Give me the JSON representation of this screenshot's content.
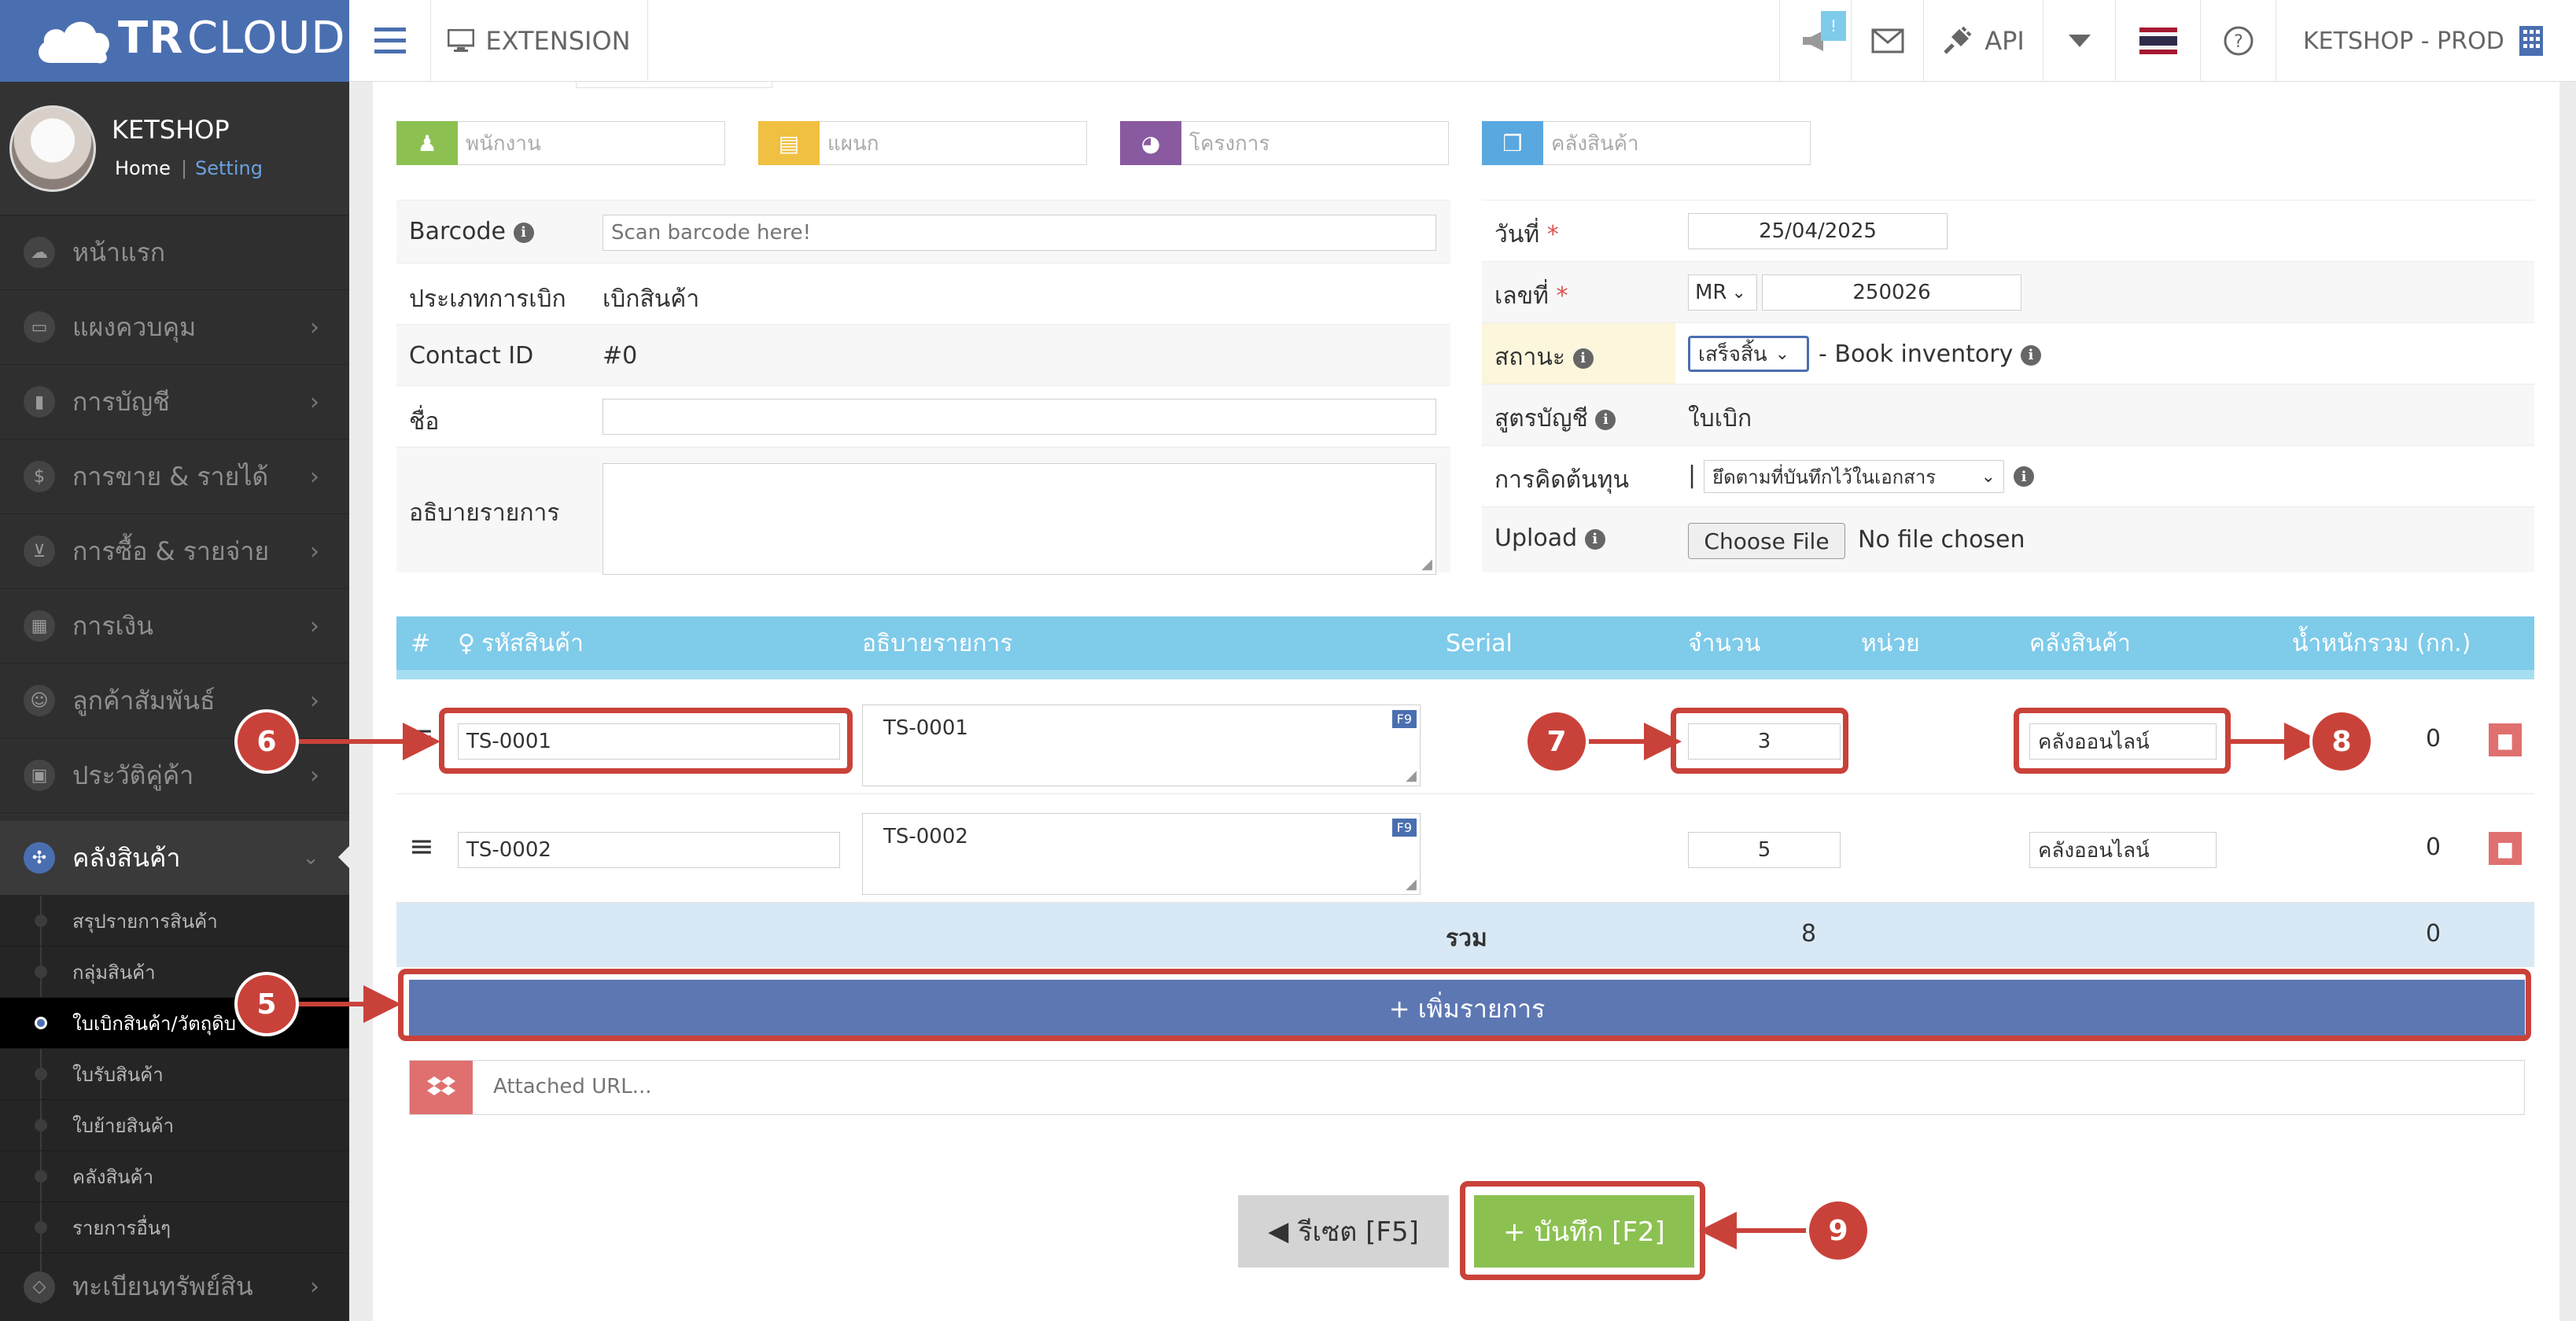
{
  "brand": {
    "tr": "TR",
    "cloud": "CLOUD"
  },
  "topbar": {
    "extension": "EXTENSION",
    "notify_count": "!",
    "api": "API",
    "account": "KETSHOP - PROD"
  },
  "profile": {
    "name": "KETSHOP",
    "home": "Home",
    "separator": "|",
    "setting": "Setting"
  },
  "nav": [
    {
      "label": "หน้าแรก",
      "icon": "cloud-icon"
    },
    {
      "label": "แผงควบคุม",
      "icon": "monitor-icon"
    },
    {
      "label": "การบัญชี",
      "icon": "book-icon"
    },
    {
      "label": "การขาย & รายได้",
      "icon": "dollar-icon"
    },
    {
      "label": "การซื้อ & รายจ่าย",
      "icon": "cart-icon"
    },
    {
      "label": "การเงิน",
      "icon": "calendar-icon"
    },
    {
      "label": "ลูกค้าสัมพันธ์",
      "icon": "users-icon"
    },
    {
      "label": "ประวัติคู่ค้า",
      "icon": "contact-book-icon"
    },
    {
      "label": "คลังสินค้า",
      "icon": "cubes-icon"
    },
    {
      "label": "ทะเบียนทรัพย์สิน",
      "icon": "diamond-icon"
    }
  ],
  "subnav": [
    "สรุปรายการสินค้า",
    "กลุ่มสินค้า",
    "ใบเบิกสินค้า/วัตถุดิบ",
    "ใบรับสินค้า",
    "ใบย้ายสินค้า",
    "คลังสินค้า",
    "รายการอื่นๆ"
  ],
  "tags": [
    "พนักงาน",
    "แผนก",
    "โครงการ",
    "คลังสินค้า"
  ],
  "form_left": {
    "barcode_label": "Barcode",
    "barcode_placeholder": "Scan barcode here!",
    "type_label": "ประเภทการเบิก",
    "type_value": "เบิกสินค้า",
    "contact_label": "Contact ID",
    "contact_value": "#0",
    "name_label": "ชื่อ",
    "desc_label": "อธิบายรายการ"
  },
  "form_right": {
    "date_label": "วันที่",
    "date_value": "25/04/2025",
    "number_label": "เลขที่",
    "number_prefix": "MR",
    "number_value": "250026",
    "status_label": "สถานะ",
    "status_value": "เสร็จสิ้น",
    "status_note": "- Book inventory",
    "formula_label": "สูตรบัญชี",
    "formula_value": "ใบเบิก",
    "cost_label": "การคิดต้นทุน",
    "cost_value": "ยึดตามที่บันทึกไว้ในเอกสาร",
    "upload_label": "Upload",
    "choose_file": "Choose File",
    "no_file": "No file chosen"
  },
  "table": {
    "headers": [
      "#",
      "รหัสสินค้า",
      "อธิบายรายการ",
      "Serial",
      "จำนวน",
      "หน่วย",
      "คลังสินค้า",
      "น้ำหนักรวม (กก.)"
    ],
    "rows": [
      {
        "code": "TS-0001",
        "desc": "TS-0001",
        "qty": "3",
        "warehouse": "คลังออนไลน์",
        "weight": "0"
      },
      {
        "code": "TS-0002",
        "desc": "TS-0002",
        "qty": "5",
        "warehouse": "คลังออนไลน์",
        "weight": "0"
      }
    ],
    "f9": "F9",
    "total_label": "รวม",
    "total_qty": "8",
    "total_weight": "0"
  },
  "actions": {
    "add_item": "+ เพิ่มรายการ",
    "url_placeholder": "Attached URL...",
    "reset": "รีเซต [F5]",
    "save": "+ บันทึก [F2]"
  },
  "annotations": [
    "5",
    "6",
    "7",
    "8",
    "9"
  ],
  "colors": {
    "brand": "#4a6fb0",
    "header": "#7fcbea",
    "save": "#8cc152",
    "annotation": "#c9423a"
  }
}
